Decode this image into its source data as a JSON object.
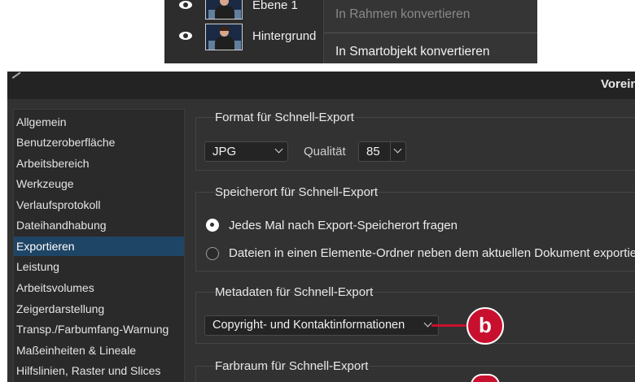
{
  "layers": {
    "rows": [
      {
        "name": "Ebene 1"
      },
      {
        "name": "Hintergrund"
      }
    ],
    "context_menu": {
      "item_disabled": "In Rahmen konvertieren",
      "item_enabled": "In Smartobjekt konvertieren"
    }
  },
  "dialog": {
    "title": "Voreinstellungen",
    "sidebar": [
      "Allgemein",
      "Benutzeroberfläche",
      "Arbeitsbereich",
      "Werkzeuge",
      "Verlaufsprotokoll",
      "Dateihandhabung",
      "Exportieren",
      "Leistung",
      "Arbeitsvolumes",
      "Zeigerdarstellung",
      "Transp./Farbumfang-Warnung",
      "Maßeinheiten & Lineale",
      "Hilfslinien, Raster und Slices"
    ],
    "active_index": 6,
    "format_section": {
      "title": "Format für Schnell-Export",
      "format_value": "JPG",
      "quality_label": "Qualität",
      "quality_value": "85"
    },
    "location_section": {
      "title": "Speicherort für Schnell-Export",
      "option_ask": "Jedes Mal nach Export-Speicherort fragen",
      "option_folder": "Dateien in einen Elemente-Ordner neben dem aktuellen Dokument exportieren"
    },
    "metadata_section": {
      "title": "Metadaten für Schnell-Export",
      "value": "Copyright- und Kontaktinformationen"
    },
    "colorspace_section": {
      "title": "Farbraum für Schnell-Export"
    }
  },
  "callout": {
    "label": "b"
  },
  "colors": {
    "accent": "#c8102e",
    "selection": "#1f4566",
    "panel": "#323232"
  }
}
